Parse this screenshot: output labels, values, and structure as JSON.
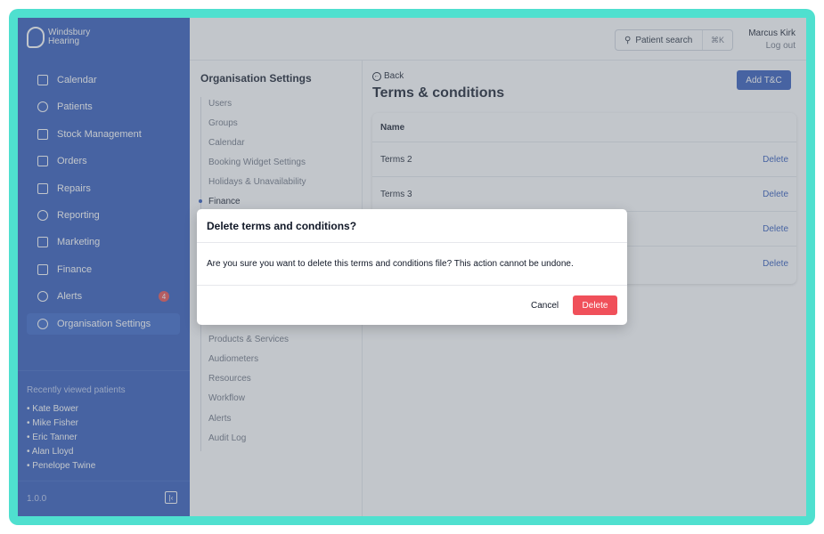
{
  "brand": {
    "line1": "Windsbury",
    "line2": "Hearing"
  },
  "sidebar": {
    "items": [
      {
        "label": "Calendar",
        "icon": "calendar-icon"
      },
      {
        "label": "Patients",
        "icon": "smile-icon"
      },
      {
        "label": "Stock Management",
        "icon": "clipboard-icon"
      },
      {
        "label": "Orders",
        "icon": "inbox-icon"
      },
      {
        "label": "Repairs",
        "icon": "wrench-icon"
      },
      {
        "label": "Reporting",
        "icon": "chart-pie-icon"
      },
      {
        "label": "Marketing",
        "icon": "mail-icon"
      },
      {
        "label": "Finance",
        "icon": "card-icon"
      },
      {
        "label": "Alerts",
        "icon": "bell-icon",
        "badge": "4"
      },
      {
        "label": "Organisation Settings",
        "icon": "gear-icon",
        "active": true
      }
    ],
    "recent_title": "Recently viewed patients",
    "recent": [
      "• Kate Bower",
      "• Mike Fisher",
      "• Eric Tanner",
      "• Alan Lloyd",
      "• Penelope Twine"
    ],
    "version": "1.0.0"
  },
  "header": {
    "search_label": "Patient search",
    "search_shortcut": "⌘K",
    "user_name": "Marcus Kirk",
    "logout": "Log out"
  },
  "settings": {
    "title": "Organisation Settings",
    "items": [
      "Users",
      "Groups",
      "Calendar",
      "Booking Widget Settings",
      "Holidays & Unavailability",
      "Finance",
      "",
      "",
      "",
      "",
      "",
      "",
      "Products & Services",
      "Audiometers",
      "Resources",
      "Workflow",
      "Alerts",
      "Audit Log"
    ],
    "active_index": 5
  },
  "main": {
    "back": "Back",
    "title": "Terms & conditions",
    "add_button": "Add T&C",
    "table_header": "Name",
    "rows": [
      {
        "name": "Terms 2",
        "action": "Delete"
      },
      {
        "name": "Terms 3",
        "action": "Delete"
      },
      {
        "name": "",
        "action": "Delete"
      },
      {
        "name": "",
        "action": "Delete"
      }
    ]
  },
  "modal": {
    "title": "Delete terms and conditions?",
    "body": "Are you sure you want to delete this terms and conditions file? This action cannot be undone.",
    "cancel": "Cancel",
    "confirm": "Delete"
  },
  "colors": {
    "sidebar": "#2b55b8",
    "accent": "#2b55b8",
    "danger": "#f0505a",
    "badge": "#e84a4a",
    "frame": "#4fe0cf"
  }
}
